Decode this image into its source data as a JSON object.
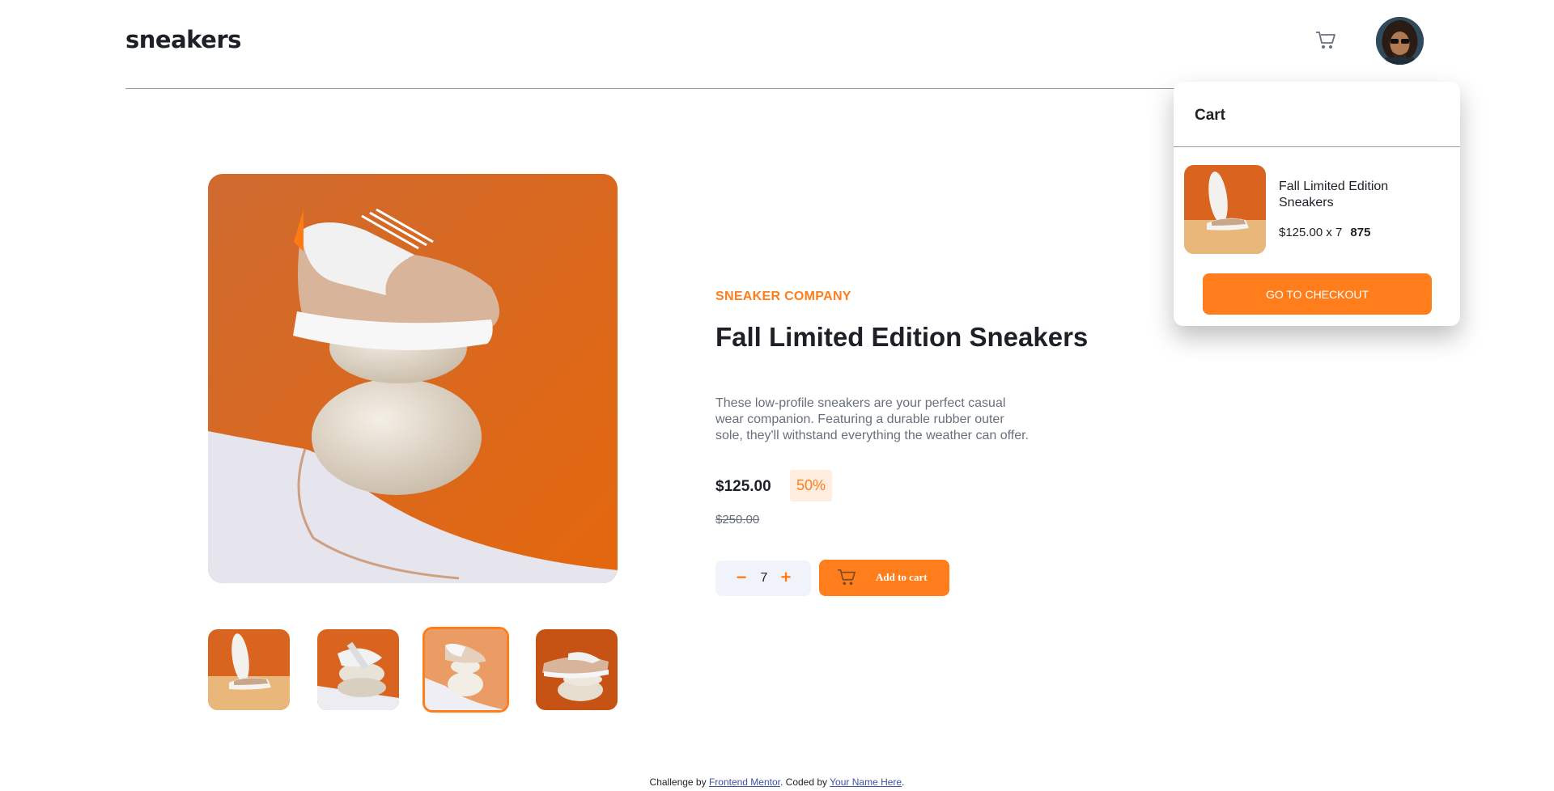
{
  "header": {
    "logo": "sneakers",
    "cart_icon": "cart-icon",
    "avatar_icon": "avatar"
  },
  "cart": {
    "title": "Cart",
    "item": {
      "name": "Fall Limited Edition Sneakers",
      "price_each": "$125.00 x 7",
      "total": "875"
    },
    "checkout_label": "GO TO CHECKOUT"
  },
  "product": {
    "company": "SNEAKER COMPANY",
    "title": "Fall Limited Edition Sneakers",
    "description": "These low-profile sneakers are your perfect casual wear companion. Featuring a durable rubber outer sole, they'll withstand everything the weather can offer.",
    "price": "$125.00",
    "discount": "50%",
    "old_price": "$250.00",
    "quantity": "7",
    "minus": "−",
    "plus": "+",
    "add_label": "Add to cart",
    "selected_thumbnail": 3
  },
  "footer": {
    "prefix": "Challenge by ",
    "link1": "Frontend Mentor",
    "middle": ". Coded by ",
    "link2": "Your Name Here",
    "suffix": "."
  },
  "colors": {
    "accent": "#ff7e1b",
    "accent_pale": "#ffede0",
    "dark": "#1d2026",
    "muted": "#68707d"
  }
}
